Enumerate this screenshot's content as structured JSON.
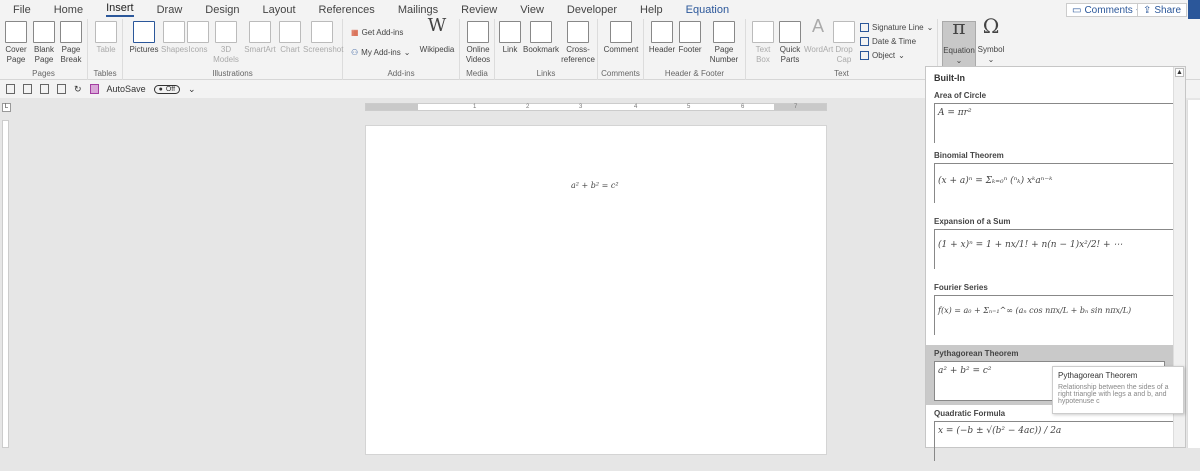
{
  "tabs": [
    "File",
    "Home",
    "Insert",
    "Draw",
    "Design",
    "Layout",
    "References",
    "Mailings",
    "Review",
    "View",
    "Developer",
    "Help",
    "Equation"
  ],
  "top": {
    "comments": "Comments",
    "share": "Share"
  },
  "groups": {
    "pages": "Pages",
    "tables": "Tables",
    "illustrations": "Illustrations",
    "addins": "Add-ins",
    "media": "Media",
    "links": "Links",
    "comments": "Comments",
    "headerfooter": "Header & Footer",
    "text": "Text"
  },
  "buttons": {
    "cover": "Cover Page",
    "blank": "Blank Page",
    "pagebreak": "Page Break",
    "table": "Table",
    "pictures": "Pictures",
    "shapes": "Shapes",
    "icons": "Icons",
    "models": "3D Models",
    "smartart": "SmartArt",
    "chart": "Chart",
    "screenshot": "Screenshot",
    "getaddins": "Get Add-ins",
    "myaddins": "My Add-ins",
    "wikipedia": "Wikipedia",
    "videos": "Online Videos",
    "link": "Link",
    "bookmark": "Bookmark",
    "crossref": "Cross-reference",
    "comment": "Comment",
    "header": "Header",
    "footer": "Footer",
    "pagenumber": "Page Number",
    "textbox": "Text Box",
    "quickparts": "Quick Parts",
    "wordart": "WordArt",
    "dropcap": "Drop Cap",
    "signature": "Signature Line",
    "datetime": "Date & Time",
    "object": "Object",
    "equation": "Equation",
    "symbol": "Symbol"
  },
  "qat": {
    "autosave": "AutoSave",
    "toggle": "Off"
  },
  "document": {
    "equation": "a² + b² = c²"
  },
  "gallery": {
    "heading": "Built-In",
    "items": [
      {
        "name": "Area of Circle",
        "formula": "A = πr²"
      },
      {
        "name": "Binomial Theorem",
        "formula": "(x + a)ⁿ = Σₖ₌₀ⁿ (ⁿₖ) xᵏaⁿ⁻ᵏ"
      },
      {
        "name": "Expansion of a Sum",
        "formula": "(1 + x)ⁿ = 1 + nx/1! + n(n − 1)x²/2! + ⋯"
      },
      {
        "name": "Fourier Series",
        "formula": "f(x) = a₀ + Σₙ₌₁^∞ (aₙ cos nπx/L + bₙ sin nπx/L)"
      },
      {
        "name": "Pythagorean Theorem",
        "formula": "a² + b² = c²"
      },
      {
        "name": "Quadratic Formula",
        "formula": "x = (−b ± √(b² − 4ac)) / 2a"
      }
    ]
  },
  "tooltip": {
    "title": "Pythagorean Theorem",
    "text": "Relationship between the sides of a right triangle with legs a and b, and hypotenuse c"
  },
  "ruler": [
    "1",
    "2",
    "3",
    "4",
    "5",
    "6",
    "7"
  ]
}
